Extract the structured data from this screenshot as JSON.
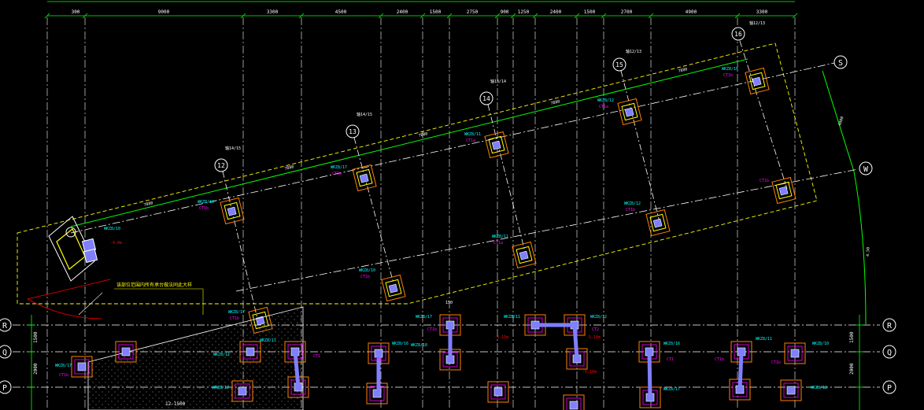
{
  "drawing": {
    "top_dimensions": [
      "300",
      "9000",
      "3300",
      "4500",
      "2400",
      "1500",
      "2750",
      "900",
      "1250",
      "2400",
      "1500",
      "2700",
      "4900",
      "3300"
    ],
    "axes": {
      "P": "P",
      "Q": "Q",
      "R": "R",
      "S": "S",
      "W": "W",
      "n12": "12",
      "n13": "13",
      "n14": "14",
      "n15": "15",
      "n16": "16"
    },
    "axis_notes": [
      "轴14/15",
      "轴14/15",
      "轴13/14",
      "轴12/13",
      "轴12/13"
    ],
    "diagonal_dimensions": [
      "7880",
      "7880",
      "7880",
      "7880",
      "7880"
    ],
    "right_dimensions": [
      "4800",
      "4.50"
    ],
    "side_dimensions": [
      "1500",
      "2000",
      "1500",
      "2000"
    ],
    "foundation_labels": [
      "WKZ8/10",
      "WKZ8/17",
      "WKZ8/11",
      "WKZ8/12",
      "WKZ8/16"
    ],
    "zone_labels": [
      "CT1b",
      "CT1a",
      "CT1",
      "CT2"
    ],
    "note": "该部位范围内所有承台做法同此大样",
    "elevation_labels": [
      "-4.0m",
      "-4.15m",
      "-5.10m"
    ],
    "side_label": "150",
    "bottom_dimension": "12-1500"
  },
  "colors": {
    "grid": "#ffffff",
    "dimension": "#00ff00",
    "boundary": "#ffff00",
    "text": "#00ffff",
    "magenta": "#ff00ff",
    "red": "#ff0000",
    "orange": "#ff8000",
    "column": "#7f7fff"
  }
}
